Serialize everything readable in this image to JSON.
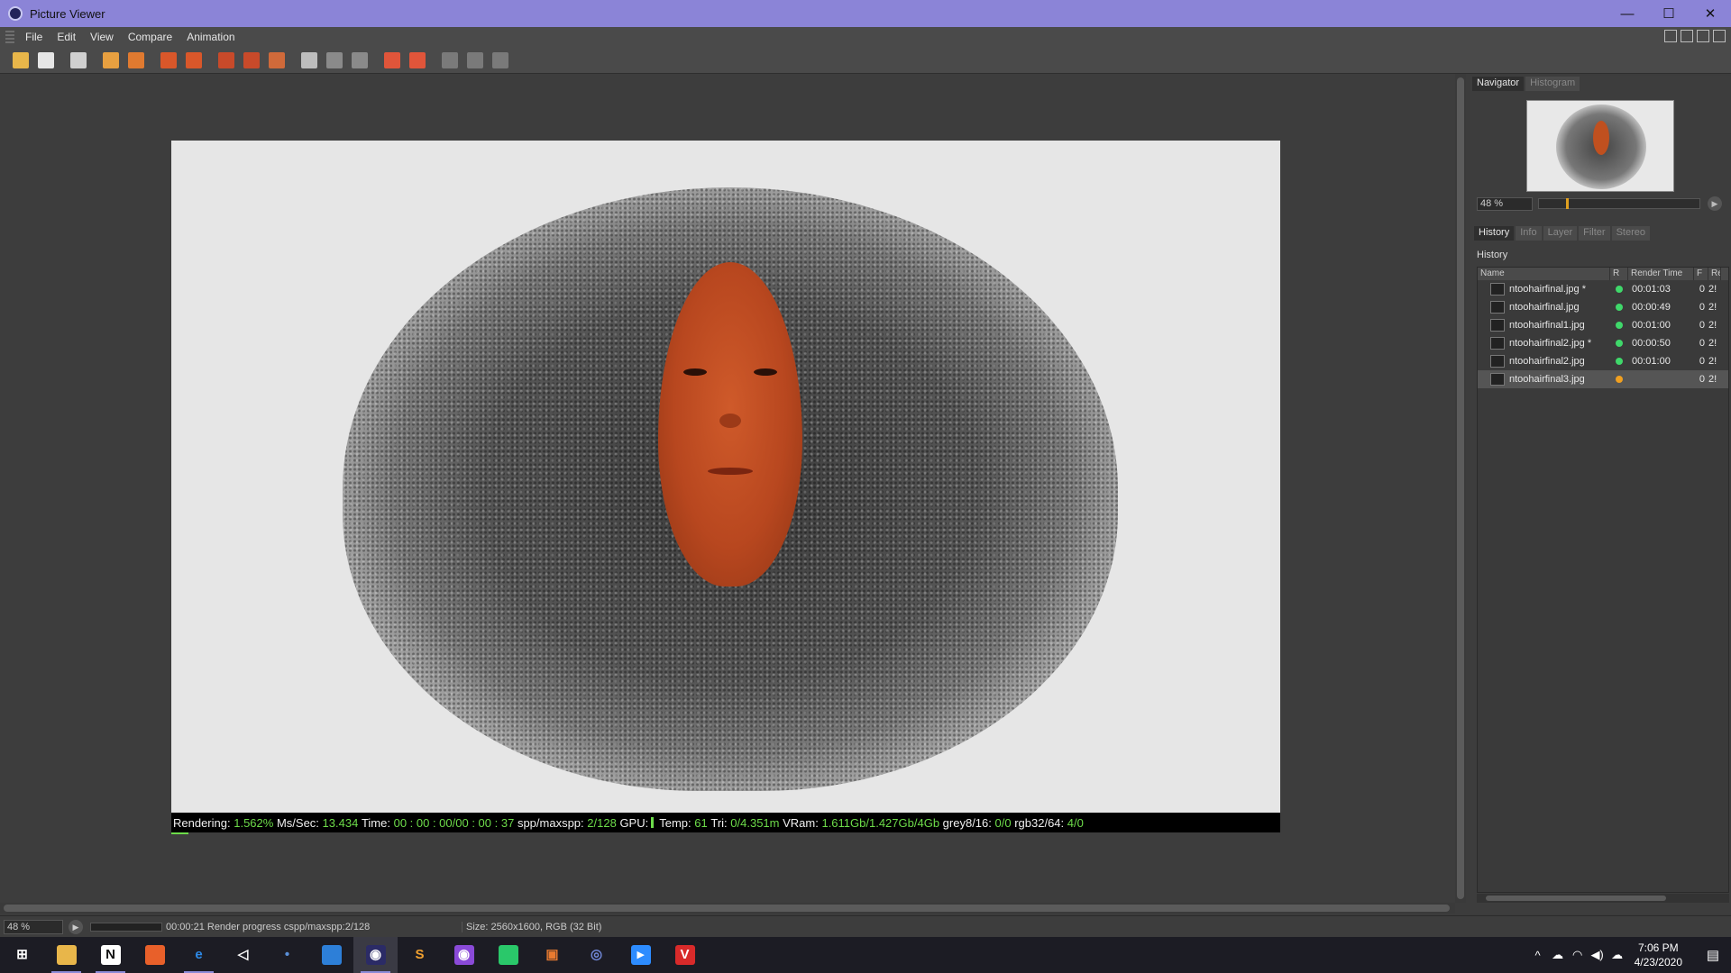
{
  "window": {
    "title": "Picture Viewer",
    "controls": [
      "—",
      "☐",
      "✕"
    ]
  },
  "menu": [
    "File",
    "Edit",
    "View",
    "Compare",
    "Animation"
  ],
  "toolbar": {
    "icons": [
      {
        "name": "open-icon",
        "color": "#e8b64a"
      },
      {
        "name": "save-icon",
        "color": "#e6e6e6"
      },
      {
        "name": "render-icon",
        "color": "#d0d0d0"
      },
      {
        "name": "fit-icon",
        "color": "#e8a040"
      },
      {
        "name": "user-icon",
        "color": "#e07a30"
      },
      {
        "name": "layer-a-icon",
        "color": "#d9572a"
      },
      {
        "name": "layer-b-icon",
        "color": "#d9572a"
      },
      {
        "name": "region-icon",
        "color": "#c84a2a"
      },
      {
        "name": "region2-icon",
        "color": "#c84a2a"
      },
      {
        "name": "compare-icon",
        "color": "#d06a3a"
      },
      {
        "name": "ab-icon",
        "color": "#bdbdbd"
      },
      {
        "name": "ab-split-icon",
        "color": "#8a8a8a"
      },
      {
        "name": "ab-swap-icon",
        "color": "#8a8a8a"
      },
      {
        "name": "set-a-icon",
        "color": "#e0553a"
      },
      {
        "name": "set-b-icon",
        "color": "#e0553a"
      },
      {
        "name": "view1-icon",
        "color": "#7a7a7a"
      },
      {
        "name": "view2-icon",
        "color": "#7a7a7a"
      },
      {
        "name": "view3-icon",
        "color": "#7a7a7a"
      }
    ]
  },
  "render_status": {
    "rendering_label": "Rendering:",
    "rendering_value": "1.562%",
    "ms_label": "Ms/Sec:",
    "ms_value": "13.434",
    "time_label": "Time:",
    "time_value": "00 : 00 : 00/00 : 00 : 37",
    "spp_label": "spp/maxspp:",
    "spp_value": "2/128",
    "gpu_label": "GPU:",
    "temp_label": "Temp:",
    "temp_value": "61",
    "tri_label": "Tri:",
    "tri_value": "0/4.351m",
    "vram_label": "VRam:",
    "vram_value": "1.611Gb/1.427Gb/4Gb",
    "grey_label": "grey8/16:",
    "grey_value": "0/0",
    "rgb_label": "rgb32/64:",
    "rgb_value": "4/0",
    "progress": 0.01562
  },
  "navigator": {
    "tabs": [
      "Navigator",
      "Histogram"
    ],
    "zoom": "48 %",
    "zoom_level": 0.48
  },
  "history_panel": {
    "tabs": [
      "History",
      "Info",
      "Layer",
      "Filter",
      "Stereo"
    ],
    "title": "History",
    "columns": [
      "Name",
      "R",
      "Render Time",
      "F",
      "Re"
    ],
    "rows": [
      {
        "name": "ntoohairfinal.jpg *",
        "status_color": "#3fd86a",
        "time": "00:01:03",
        "f": "0",
        "re": "2!",
        "selected": false
      },
      {
        "name": "ntoohairfinal.jpg",
        "status_color": "#3fd86a",
        "time": "00:00:49",
        "f": "0",
        "re": "2!",
        "selected": false
      },
      {
        "name": "ntoohairfinal1.jpg",
        "status_color": "#3fd86a",
        "time": "00:01:00",
        "f": "0",
        "re": "2!",
        "selected": false
      },
      {
        "name": "ntoohairfinal2.jpg *",
        "status_color": "#3fd86a",
        "time": "00:00:50",
        "f": "0",
        "re": "2!",
        "selected": false
      },
      {
        "name": "ntoohairfinal2.jpg",
        "status_color": "#3fd86a",
        "time": "00:01:00",
        "f": "0",
        "re": "2!",
        "selected": false
      },
      {
        "name": "ntoohairfinal3.jpg",
        "status_color": "#f0a020",
        "time": "",
        "f": "0",
        "re": "2!",
        "selected": true
      }
    ]
  },
  "statusbar": {
    "zoom": "48 %",
    "status": "00:00:21 Render progress  cspp/maxspp:2/128",
    "size": "Size: 2560x1600, RGB (32 Bit)"
  },
  "taskbar": {
    "apps": [
      {
        "name": "start-icon",
        "glyph": "⊞",
        "color": "#1c1c24",
        "fg": "#ffffff",
        "running": false,
        "active": false
      },
      {
        "name": "file-explorer-icon",
        "glyph": "",
        "color": "#e8b64a",
        "fg": "#ffffff",
        "running": true,
        "active": false
      },
      {
        "name": "notion-icon",
        "glyph": "N",
        "color": "#ffffff",
        "fg": "#111111",
        "running": true,
        "active": false
      },
      {
        "name": "firefox-icon",
        "glyph": "",
        "color": "#e8602a",
        "fg": "#ffffff",
        "running": false,
        "active": false
      },
      {
        "name": "edge-icon",
        "glyph": "e",
        "color": "#1c1c24",
        "fg": "#2d8ae8",
        "running": true,
        "active": false
      },
      {
        "name": "unity-icon",
        "glyph": "◁",
        "color": "#1c1c24",
        "fg": "#ffffff",
        "running": false,
        "active": false
      },
      {
        "name": "app-dots-icon",
        "glyph": "•",
        "color": "#1c1c24",
        "fg": "#5a8fd8",
        "running": false,
        "active": false
      },
      {
        "name": "store-icon",
        "glyph": "",
        "color": "#2d7fd8",
        "fg": "#ffffff",
        "running": false,
        "active": false
      },
      {
        "name": "cinema4d-icon",
        "glyph": "◉",
        "color": "#2b2b66",
        "fg": "#ffffff",
        "running": true,
        "active": true
      },
      {
        "name": "sublime-icon",
        "glyph": "S",
        "color": "#1c1c24",
        "fg": "#f0a030",
        "running": false,
        "active": false
      },
      {
        "name": "app-purple-icon",
        "glyph": "◉",
        "color": "#8a4ad8",
        "fg": "#ffffff",
        "running": false,
        "active": false
      },
      {
        "name": "app-flag-icon",
        "glyph": "",
        "color": "#2ac86a",
        "fg": "#ffffff",
        "running": false,
        "active": false
      },
      {
        "name": "app-square-icon",
        "glyph": "▣",
        "color": "#1c1c24",
        "fg": "#e87a30",
        "running": false,
        "active": false
      },
      {
        "name": "discord-icon",
        "glyph": "◎",
        "color": "#1c1c24",
        "fg": "#7289da",
        "running": false,
        "active": false
      },
      {
        "name": "zoom-icon",
        "glyph": "▸",
        "color": "#2d8cff",
        "fg": "#ffffff",
        "running": false,
        "active": false
      },
      {
        "name": "app-red-icon",
        "glyph": "V",
        "color": "#d82a2a",
        "fg": "#ffffff",
        "running": false,
        "active": false
      }
    ],
    "time": "7:06 PM",
    "date": "4/23/2020"
  }
}
